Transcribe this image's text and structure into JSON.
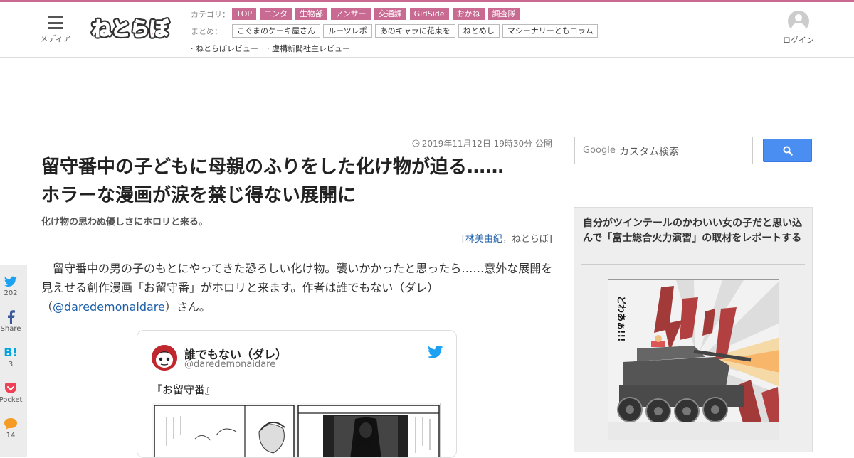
{
  "header": {
    "menu_label": "メディア",
    "logo_text": "ねとらぼ",
    "category_label": "カテゴリ：",
    "categories": [
      "TOP",
      "エンタ",
      "生物部",
      "アンサー",
      "交通課",
      "GirlSide",
      "おかね",
      "調査隊"
    ],
    "matome_label": "まとめ：",
    "matome": [
      "こぐまのケーキ屋さん",
      "ルーツレポ",
      "あのキャラに花束を",
      "ねとめし",
      "マシーナリーともコラム"
    ],
    "reviews": [
      "· ねとらぼレビュー",
      "· 虚構新聞社主レビュー"
    ],
    "login_label": "ログイン"
  },
  "article": {
    "date": "2019年11月12日 19時30分 公開",
    "title_line1": "留守番中の子どもに母親のふりをした化け物が迫る……",
    "title_line2": "ホラーな漫画が涙を禁じ得ない展開に",
    "subtitle": "化け物の思わぬ優しさにホロリと来る。",
    "byline_open": "[",
    "byline_author": "林美由紀",
    "byline_sep": "，",
    "byline_site": "ねとらぼ",
    "byline_close": "]",
    "body_part1": "　留守番中の男の子のもとにやってきた恐ろしい化け物。襲いかかったと思ったら……意外な展開を見えせる創作漫画「お留守番」がホロリと来ます。作者は誰でもない（ダレ）（",
    "body_link": "@daredemonaidare",
    "body_part2": "）さん。"
  },
  "tweet": {
    "name": "誰でもない（ダレ）",
    "handle": "@daredemonaidare",
    "text": "『お留守番』"
  },
  "share": [
    {
      "icon": "twitter-icon",
      "count": "202"
    },
    {
      "icon": "facebook-icon",
      "count": "Share"
    },
    {
      "icon": "hatena-bookmark-icon",
      "label": "B!",
      "count": "3"
    },
    {
      "icon": "pocket-icon",
      "count": "Pocket"
    },
    {
      "icon": "comment-icon",
      "count": "14"
    }
  ],
  "search": {
    "brand": "Google",
    "placeholder": "カスタム検索"
  },
  "sidebar": {
    "headline": "自分がツインテールのかわいい女の子だと思い込んで「富士総合火力演習」の取材をレポートする",
    "manga_sfx": "どわあぁ!!!"
  },
  "colors": {
    "accent": "#c96a92",
    "link": "#1a5ea8",
    "search_button": "#4b8ef1",
    "twitter": "#1da1f2"
  }
}
